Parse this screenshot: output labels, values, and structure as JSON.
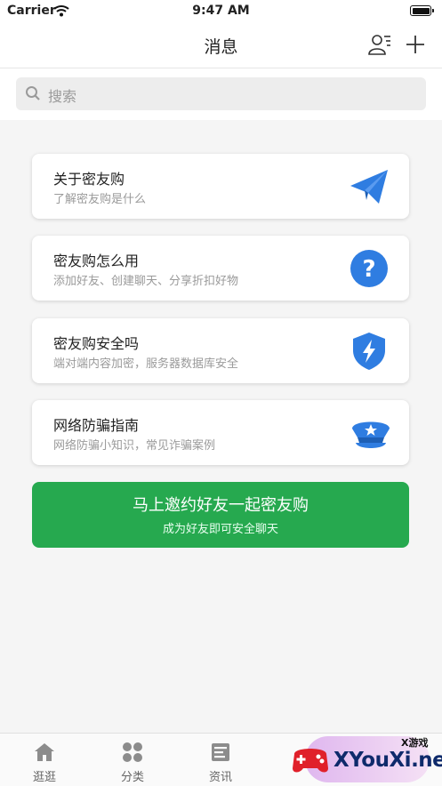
{
  "status_bar": {
    "carrier": "Carrier",
    "time": "9:47 AM"
  },
  "nav": {
    "title": "消息",
    "icons": [
      "contacts-icon",
      "plus-icon"
    ]
  },
  "search": {
    "placeholder": "搜索"
  },
  "cards": [
    {
      "title": "关于密友购",
      "subtitle": "了解密友购是什么",
      "icon": "paper-plane-icon",
      "color": "#2f7de1"
    },
    {
      "title": "密友购怎么用",
      "subtitle": "添加好友、创建聊天、分享折扣好物",
      "icon": "question-mark-icon",
      "color": "#2f7de1"
    },
    {
      "title": "密友购安全吗",
      "subtitle": "端对端内容加密，服务器数据库安全",
      "icon": "shield-bolt-icon",
      "color": "#2f7de1"
    },
    {
      "title": "网络防骗指南",
      "subtitle": "网络防骗小知识，常见诈骗案例",
      "icon": "police-cap-icon",
      "color": "#2f7de1"
    }
  ],
  "invite": {
    "title": "马上邀约好友一起密友购",
    "subtitle": "成为好友即可安全聊天",
    "color": "#26a94f"
  },
  "tabs": [
    {
      "label": "逛逛",
      "icon": "home-icon"
    },
    {
      "label": "分类",
      "icon": "category-icon"
    },
    {
      "label": "资讯",
      "icon": "news-icon"
    }
  ],
  "watermark": {
    "small": "X游戏",
    "text": "XYouXi.net"
  }
}
